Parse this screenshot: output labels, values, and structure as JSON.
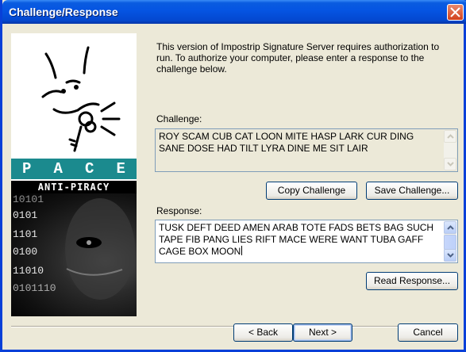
{
  "window": {
    "title": "Challenge/Response"
  },
  "logo": {
    "pace": [
      "P",
      "A",
      "C",
      "E"
    ],
    "anti_piracy": "ANTI-PIRACY",
    "binary_lines": [
      "10101",
      "0101",
      "1101",
      "0100",
      "11010",
      "0101110"
    ]
  },
  "intro_text": "This version of Impostrip Signature Server requires authorization to run. To authorize your computer, please enter a response to the challenge below.",
  "challenge": {
    "label": "Challenge:",
    "text": "ROY SCAM CUB CAT LOON MITE HASP LARK CUR DING SANE DOSE HAD TILT LYRA DINE ME SIT LAIR",
    "copy_button": "Copy Challenge",
    "save_button": "Save Challenge..."
  },
  "response": {
    "label": "Response:",
    "text": "TUSK DEFT DEED AMEN ARAB TOTE FADS BETS BAG SUCH TAPE FIB PANG LIES RIFT MACE WERE WANT TUBA GAFF CAGE BOX MOON",
    "read_button": "Read Response..."
  },
  "footer": {
    "back": "< Back",
    "next": "Next >",
    "cancel": "Cancel"
  },
  "colors": {
    "titlebar": "#0554e2",
    "pace_band": "#1b8a8e",
    "window_bg": "#ece9d8"
  }
}
